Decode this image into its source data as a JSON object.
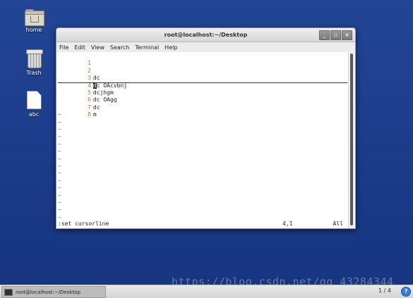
{
  "desktop": {
    "icons": [
      {
        "label": "home"
      },
      {
        "label": "Trash"
      },
      {
        "label": "abc"
      }
    ]
  },
  "window": {
    "title": "root@localhost:~/Desktop",
    "buttons": [
      "_",
      "▫",
      "×"
    ],
    "menu": [
      "File",
      "Edit",
      "View",
      "Search",
      "Terminal",
      "Help"
    ]
  },
  "editor": {
    "lines": [
      {
        "num": "1",
        "text": ""
      },
      {
        "num": "2",
        "text": ""
      },
      {
        "num": "3",
        "text": "dc"
      },
      {
        "num": "4",
        "cursor_char": "d",
        "text": "c OAcvbnj"
      },
      {
        "num": "5",
        "text": "dcjhgm"
      },
      {
        "num": "6",
        "text": "dc OAgg"
      },
      {
        "num": "7",
        "text": "dc"
      },
      {
        "num": "8",
        "text": "m"
      }
    ],
    "tilde": "~",
    "tilde_count": 15,
    "status": {
      "command": ":set cursorline",
      "position": "4,1",
      "scroll": "All"
    }
  },
  "taskbar": {
    "task_label": "root@localhost:~/Desktop",
    "workspace": "1 / 4",
    "help": "?"
  },
  "watermark": "https://blog.csdn.net/qq_43284344"
}
